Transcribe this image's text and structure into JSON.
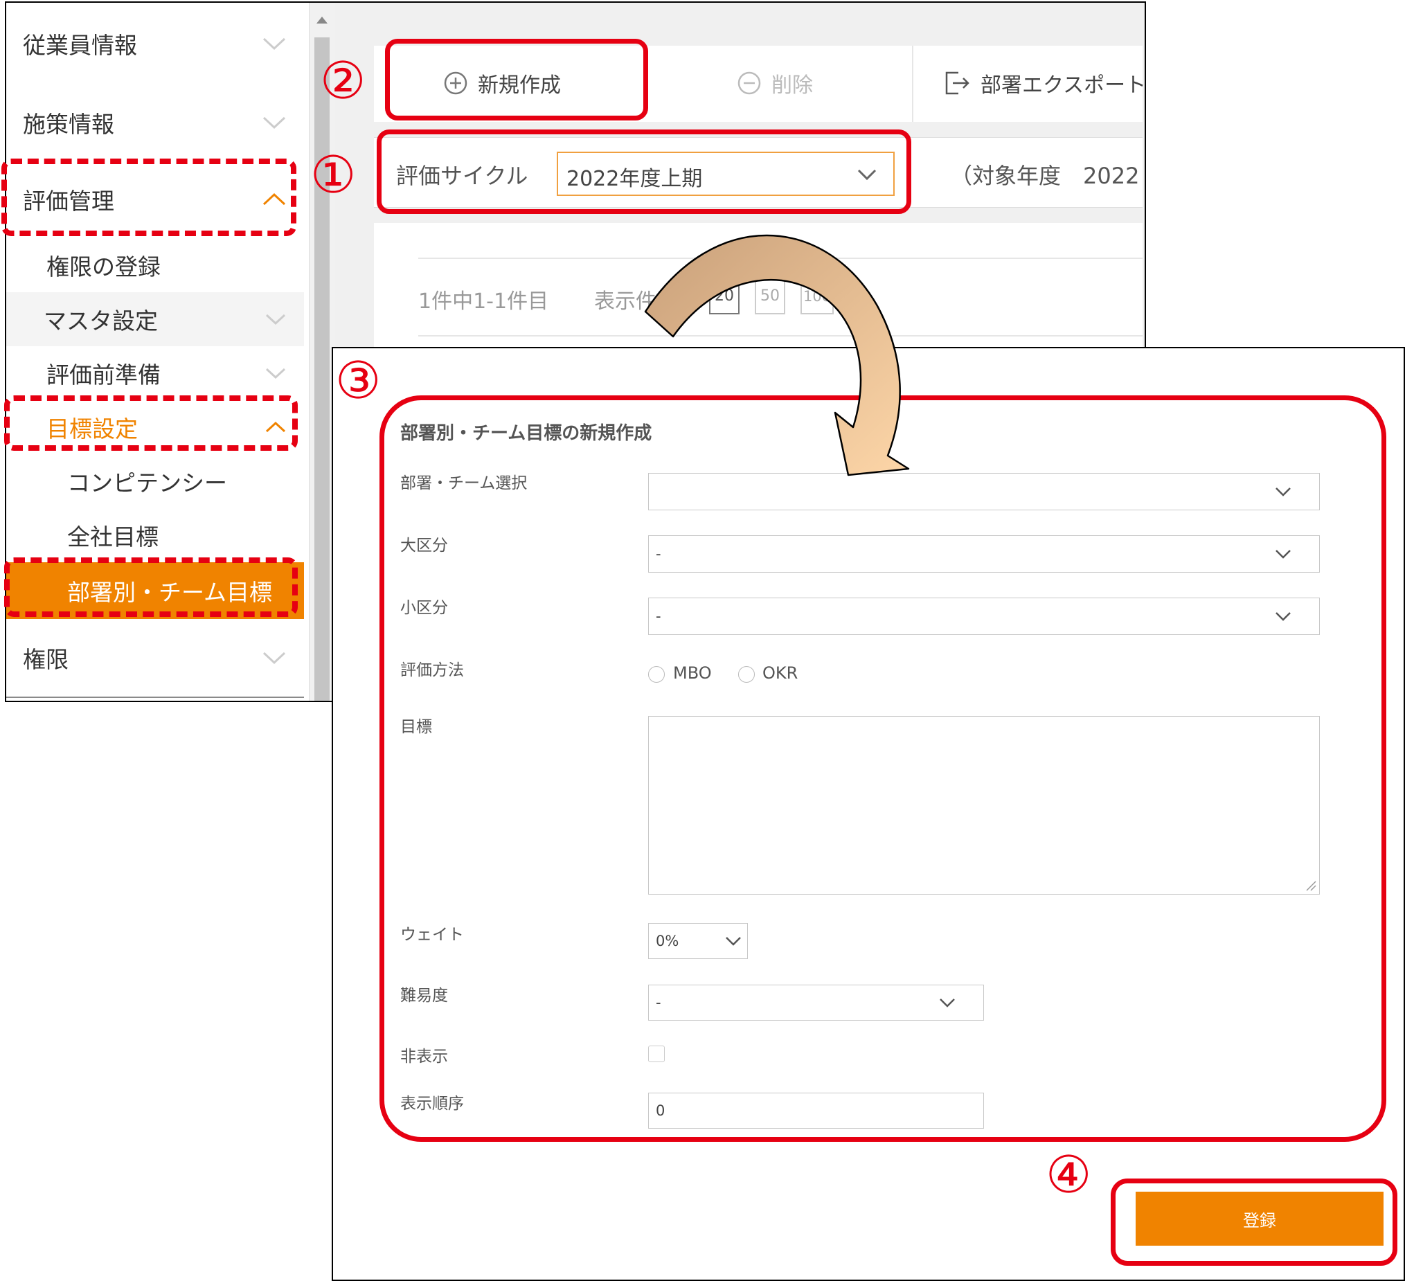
{
  "sidebar": {
    "items": [
      {
        "label": "従業員情報"
      },
      {
        "label": "施策情報"
      },
      {
        "label": "評価管理"
      },
      {
        "label": "権限の登録"
      },
      {
        "label": "マスタ設定"
      },
      {
        "label": "評価前準備"
      },
      {
        "label": "目標設定"
      },
      {
        "label": "コンピテンシー"
      },
      {
        "label": "全社目標"
      },
      {
        "label": "部署別・チーム目標"
      },
      {
        "label": "権限"
      }
    ]
  },
  "toolbar": {
    "new_label": "新規作成",
    "delete_label": "削除",
    "export_label": "部署エクスポート"
  },
  "filter": {
    "cycle_label": "評価サイクル",
    "cycle_value": "2022年度上期",
    "target_year_text": "（対象年度　2022"
  },
  "list": {
    "count_text": "1件中1-1件目",
    "per_page_label": "表示件",
    "page_sizes": [
      "20",
      "50",
      "100"
    ]
  },
  "form": {
    "title": "部署別・チーム目標の新規作成",
    "fields": {
      "dept_label": "部署・チーム選択",
      "dept_value": "",
      "major_label": "大区分",
      "major_value": "-",
      "minor_label": "小区分",
      "minor_value": "-",
      "method_label": "評価方法",
      "method_options": [
        "MBO",
        "OKR"
      ],
      "goal_label": "目標",
      "goal_value": "",
      "weight_label": "ウェイト",
      "weight_value": "0%",
      "difficulty_label": "難易度",
      "difficulty_value": "-",
      "hidden_label": "非表示",
      "order_label": "表示順序",
      "order_value": "0"
    },
    "submit_label": "登録"
  },
  "annotations": [
    "①",
    "②",
    "③",
    "④"
  ],
  "colors": {
    "accent": "#f08300",
    "annotation_red": "#e60012",
    "arrow_fill_start": "#c9a07a",
    "arrow_fill_end": "#fdd6a8"
  }
}
